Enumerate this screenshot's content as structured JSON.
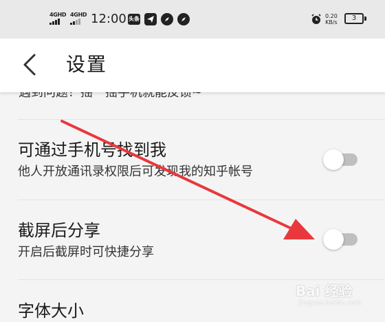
{
  "status_bar": {
    "net1_label": "4GHD",
    "net2_label": "4GHD",
    "time": "12:00",
    "badge": "头条",
    "speed_value": "0.20",
    "speed_unit": "KB/s",
    "battery": "3",
    "icons": [
      "signal-icon",
      "signal-icon",
      "telegram-icon",
      "compass-icon",
      "compass-icon",
      "alarm-icon",
      "battery-icon"
    ]
  },
  "header": {
    "back_icon": "chevron-left-icon",
    "title": "设置"
  },
  "settings": {
    "partial_row_text": "遇到问题？摇一摇手机就能反馈~",
    "rows": [
      {
        "title": "可通过手机号找到我",
        "subtitle": "他人开放通讯录权限后可发现我的知乎帐号",
        "toggle_on": false
      },
      {
        "title": "截屏后分享",
        "subtitle": "开启后截屏时可快捷分享",
        "toggle_on": false
      }
    ],
    "font_size_title": "字体大小"
  },
  "colors": {
    "toggle_off_track": "#bfbfbf",
    "annotation_arrow": "#e8383d",
    "header_bg": "#ffffff",
    "list_bg": "#f4f4f4"
  },
  "watermark": {
    "text": "Bai 经验",
    "sub": "jingyan.baidu.com"
  }
}
